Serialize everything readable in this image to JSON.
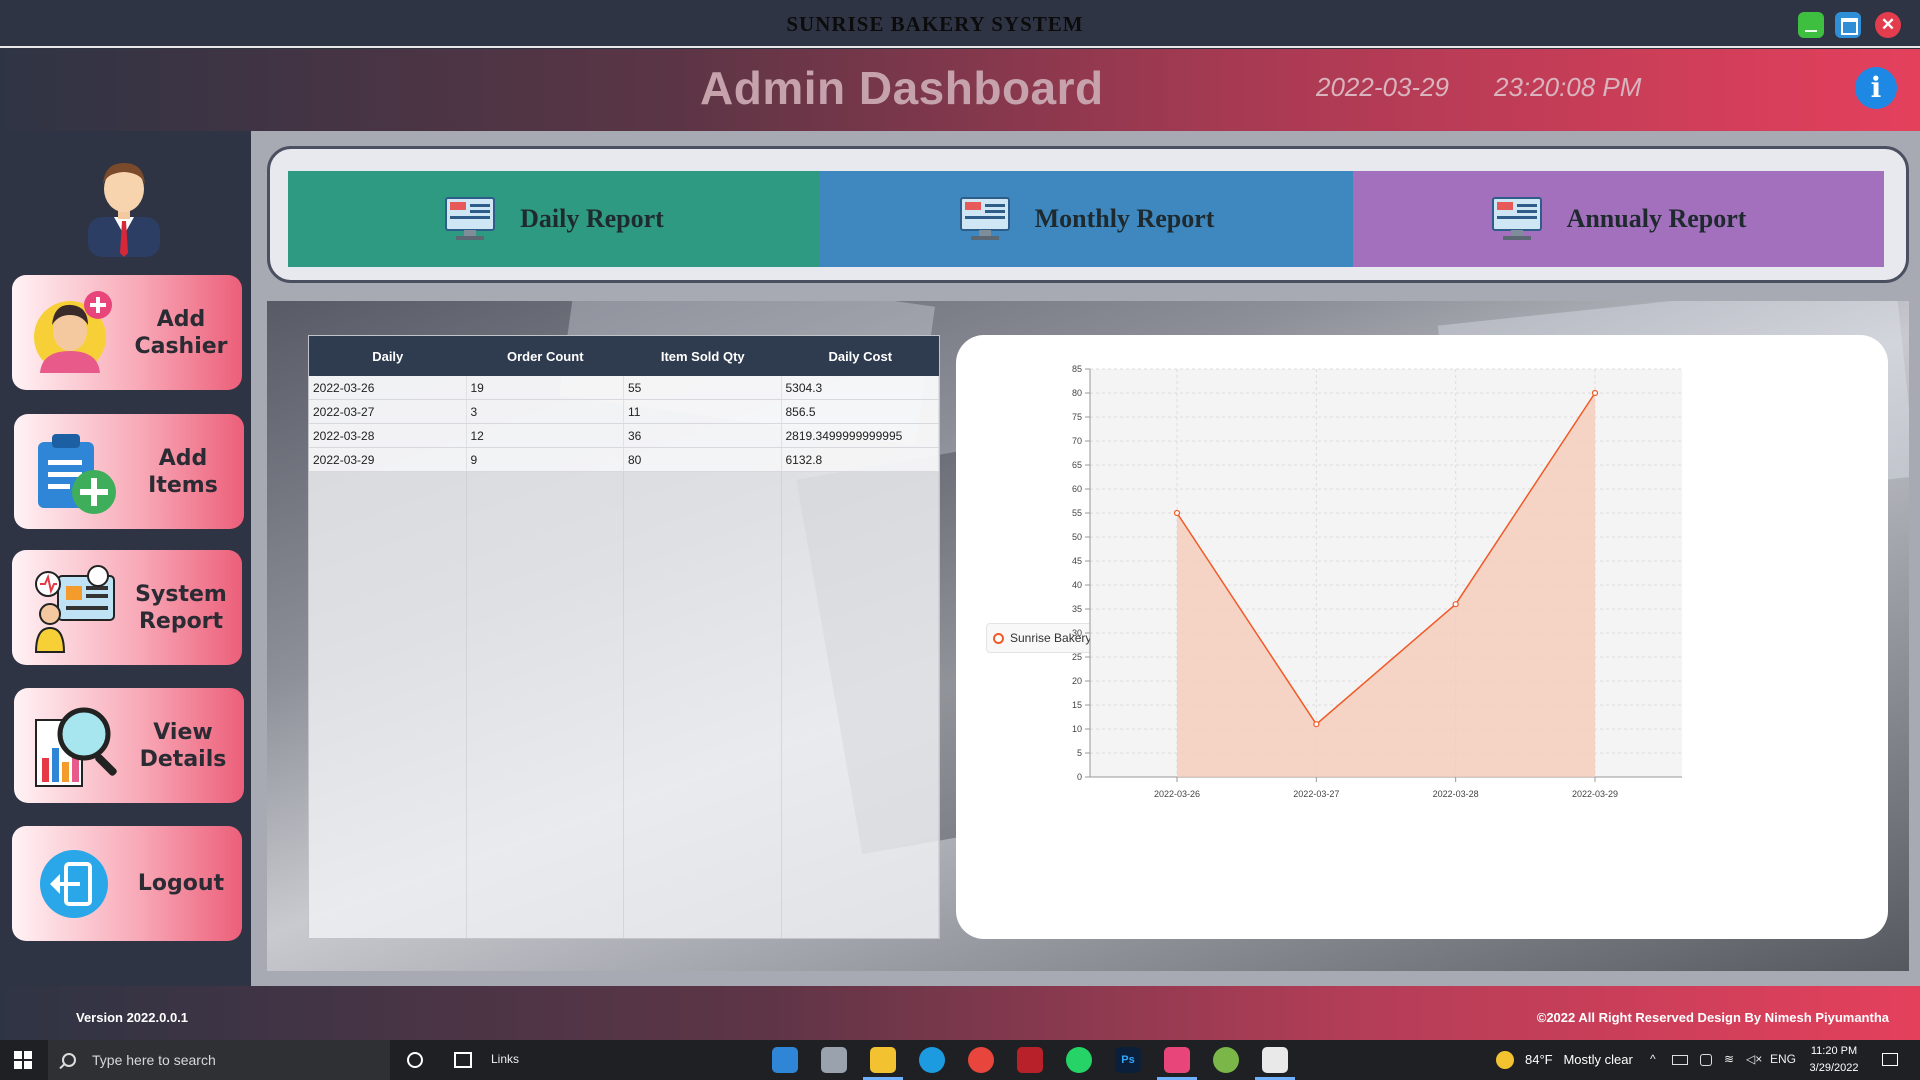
{
  "window": {
    "app_title": "SUNRISE BAKERY SYSTEM",
    "close_glyph": "✕"
  },
  "header": {
    "title": "Admin Dashboard",
    "date": "2022-03-29",
    "time": "23:20:08 PM",
    "info_glyph": "i"
  },
  "sidebar": {
    "items": [
      {
        "label": "Add\nCashier",
        "icon": "add-cashier-icon"
      },
      {
        "label": "Add\nItems",
        "icon": "add-items-icon"
      },
      {
        "label": "System\nReport",
        "icon": "system-report-icon"
      },
      {
        "label": "View\nDetails",
        "icon": "view-details-icon"
      },
      {
        "label": "Logout",
        "icon": "logout-icon"
      }
    ]
  },
  "reports": {
    "daily": "Daily Report",
    "monthly": "Monthly Report",
    "annual": "Annualy Report"
  },
  "table": {
    "headers": [
      "Daily",
      "Order Count",
      "Item Sold Qty",
      "Daily Cost"
    ],
    "rows": [
      [
        "2022-03-26",
        "19",
        "55",
        "5304.3"
      ],
      [
        "2022-03-27",
        "3",
        "11",
        "856.5"
      ],
      [
        "2022-03-28",
        "12",
        "36",
        "2819.3499999999995"
      ],
      [
        "2022-03-29",
        "9",
        "80",
        "6132.8"
      ]
    ]
  },
  "chart_data": {
    "type": "area",
    "categories": [
      "2022-03-26",
      "2022-03-27",
      "2022-03-28",
      "2022-03-29"
    ],
    "series": [
      {
        "name": "Sunrise Bakery",
        "values": [
          55,
          11,
          36,
          80
        ]
      }
    ],
    "ylim": [
      0,
      85
    ],
    "yticks": [
      0,
      5,
      10,
      15,
      20,
      25,
      30,
      35,
      40,
      45,
      50,
      55,
      60,
      65,
      70,
      75,
      80,
      85
    ],
    "grid": true,
    "legend_position": "left",
    "colors": {
      "line": "#f05a28",
      "fill": "#f6c9b6"
    }
  },
  "footer": {
    "version": "Version 2022.0.0.1",
    "copyright": "©2022  All Right Reserved Design By Nimesh Piyumantha"
  },
  "taskbar": {
    "search_placeholder": "Type here to search",
    "links": "Links",
    "temperature": "84°F",
    "weather": "Mostly clear",
    "language": "ENG",
    "clock_time": "11:20 PM",
    "clock_date": "3/29/2022"
  }
}
